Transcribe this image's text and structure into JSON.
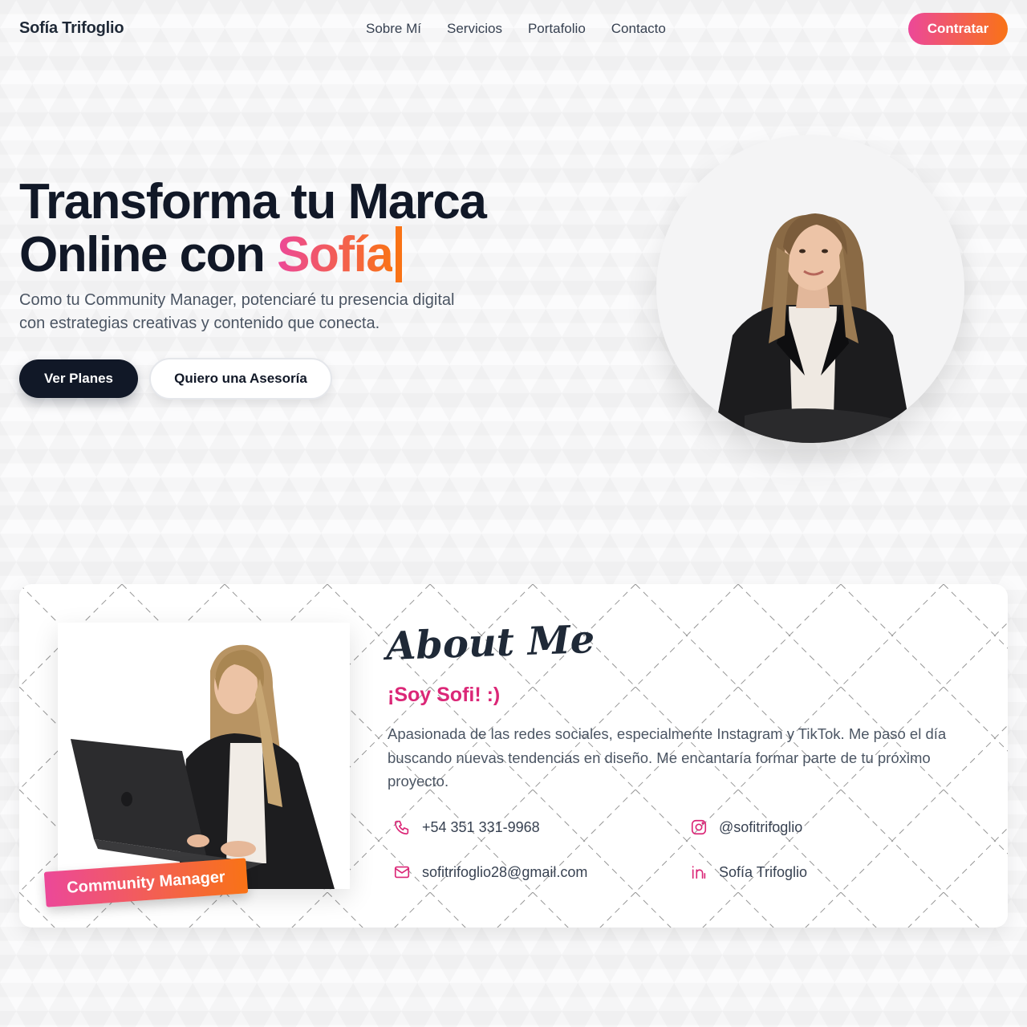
{
  "header": {
    "brand": "Sofía Trifoglio",
    "nav": [
      "Sobre Mí",
      "Servicios",
      "Portafolio",
      "Contacto"
    ],
    "cta": "Contratar"
  },
  "hero": {
    "title_line1": "Transforma tu Marca",
    "title_line2_prefix": "Online con ",
    "title_highlight": "Sofía",
    "subtitle": "Como tu Community Manager, potenciaré tu presencia digital con estrategias creativas y contenido que conecta.",
    "primary_button": "Ver Planes",
    "secondary_button": "Quiero una Asesoría"
  },
  "about": {
    "title": "About Me",
    "greeting": "¡Soy Sofi! :)",
    "description": "Apasionada de las redes sociales, especialmente Instagram y TikTok. Me paso el día buscando nuevas tendencias en diseño. Me encantaría formar parte de tu próximo proyecto.",
    "badge": "Community Manager",
    "contacts": {
      "phone": "+54 351 331-9968",
      "instagram": "@sofitrifoglio",
      "email": "sofitrifoglio28@gmail.com",
      "linkedin": "Sofía Trifoglio"
    }
  },
  "colors": {
    "accent_pink": "#ec4899",
    "accent_orange": "#f97316",
    "dark": "#111827"
  },
  "icons": [
    "phone-icon",
    "instagram-icon",
    "mail-icon",
    "linkedin-icon"
  ]
}
